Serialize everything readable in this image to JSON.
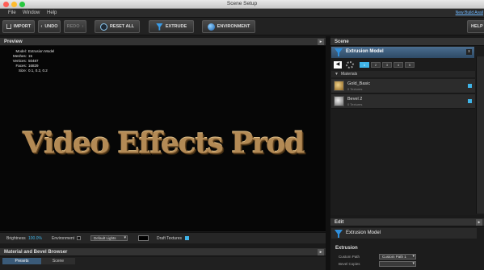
{
  "window": {
    "title": "Scene Setup"
  },
  "menubar": {
    "items": [
      "File",
      "Window",
      "Help"
    ],
    "new_build": "New Build Avail"
  },
  "toolbar": {
    "import": "IMPORT",
    "undo": "UNDO",
    "redo": "REDO",
    "reset": "RESET ALL",
    "extrude": "EXTRUDE",
    "environment": "ENVIRONMENT",
    "help": "HELP"
  },
  "preview": {
    "title": "Preview",
    "stats": {
      "labels": [
        "Model:",
        "Meshes:",
        "Vertices:",
        "Faces:",
        "Size:"
      ],
      "values": [
        "Extrusion Model",
        "15",
        "50487",
        "16829",
        "0.1, 0.2, 0.2"
      ]
    },
    "render_text": "Video Effects Prod"
  },
  "statusbar": {
    "brightness_label": "Brightness",
    "brightness_value": "100.0%",
    "environment_label": "Environment",
    "lights_value": "Default Lights",
    "draft_label": "Draft Textures"
  },
  "bottom_panel": {
    "title": "Material and Bevel Browser",
    "tabs": [
      "Presets",
      "Scene"
    ]
  },
  "scene": {
    "title": "Scene",
    "model_name": "Extrusion Model",
    "tab_numbers": [
      "1",
      "2",
      "3",
      "4",
      "5"
    ],
    "materials_label": "Materials",
    "materials": [
      {
        "name": "Gold_Basic",
        "sub": "0 Textures"
      },
      {
        "name": "Bevel 2",
        "sub": "0 Textures"
      }
    ]
  },
  "edit": {
    "title": "Edit",
    "model_name": "Extrusion Model",
    "section": "Extrusion",
    "custom_path_label": "Custom Path",
    "custom_path_value": "Custom Path 1",
    "bevel_copies_label": "Bevel Copies"
  },
  "colors": {
    "accent": "#3fb4e8",
    "gold": "#b38a55",
    "panel": "#333333"
  }
}
